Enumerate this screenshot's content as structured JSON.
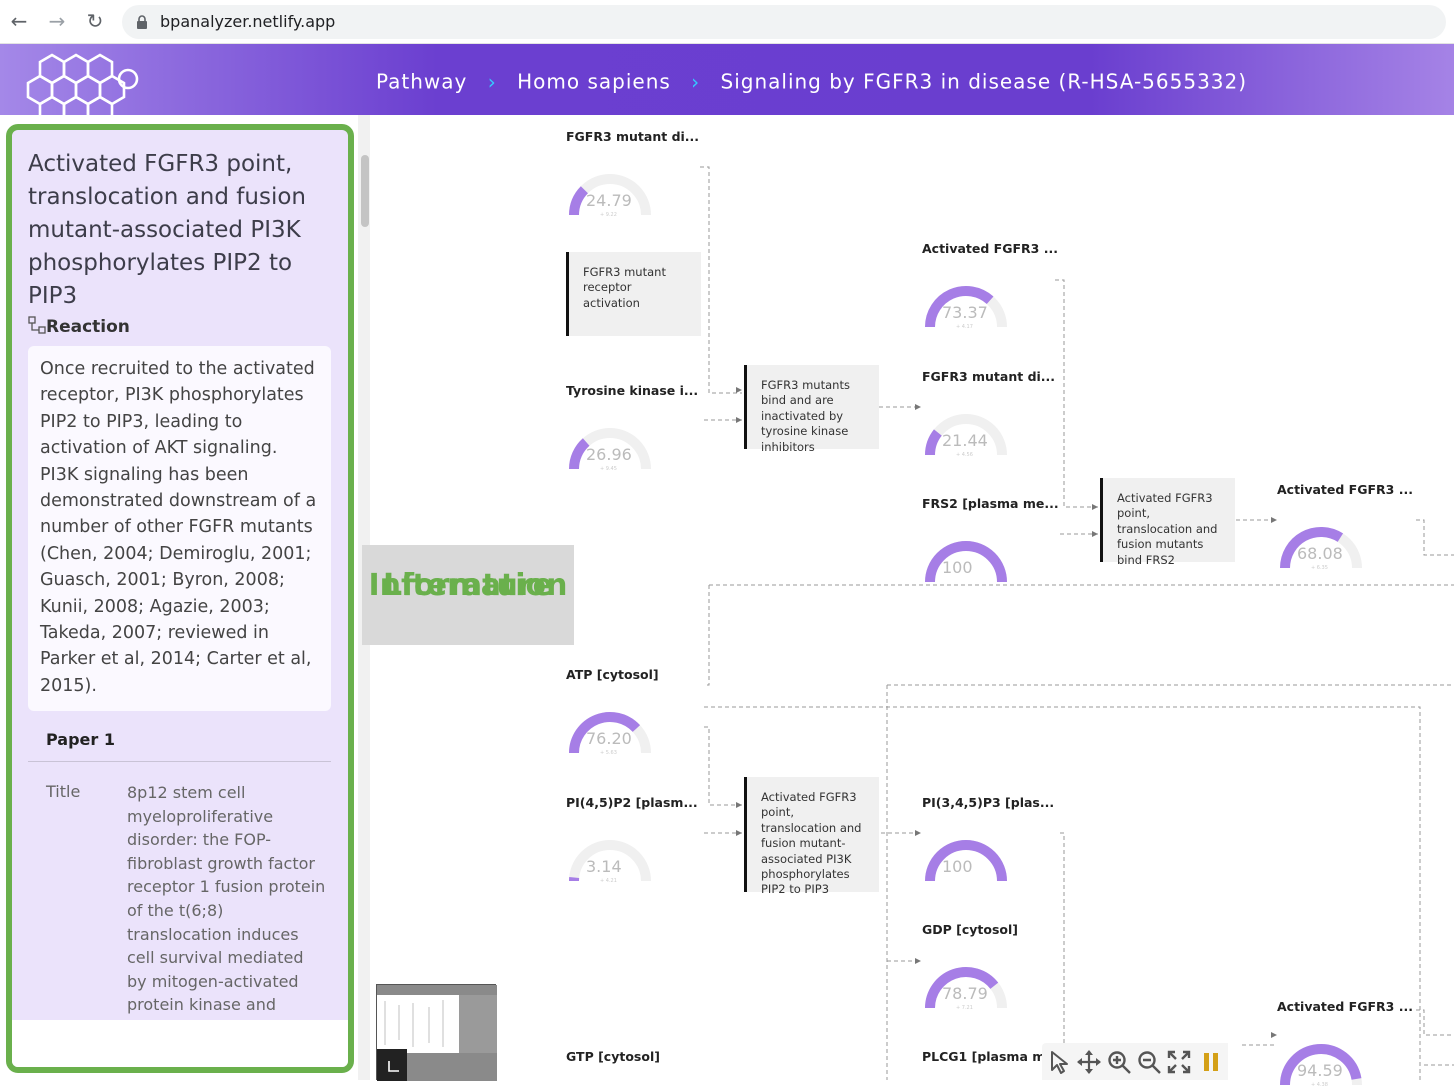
{
  "browser": {
    "url": "bpanalyzer.netlify.app",
    "back_icon": "←",
    "forward_icon": "→",
    "reload_icon": "↻"
  },
  "header": {
    "breadcrumbs": [
      "Pathway",
      "Homo sapiens",
      "Signaling by FGFR3 in disease (R-HSA-5655332)"
    ],
    "separator": "›"
  },
  "panel": {
    "title": "Activated FGFR3 point, translocation and fusion mutant-associated PI3K phosphorylates PIP2 to PIP3",
    "type": "Reaction",
    "description": "Once recruited to the activated receptor, PI3K phosphorylates PIP2 to PIP3, leading to activation of AKT signaling. PI3K signaling has been demonstrated downstream of a number of other FGFR mutants (Chen, 2004; Demiroglu, 2001; Guasch, 2001; Byron, 2008; Kunii, 2008; Agazie, 2003; Takeda, 2007; reviewed in Parker et al, 2014; Carter et al, 2015).",
    "paper_heading": "Paper 1",
    "paper_title_label": "Title",
    "paper_title": "8p12 stem cell myeloproliferative disorder: the FOP-fibroblast growth factor receptor 1 fusion protein of the t(6;8) translocation induces cell survival mediated by mitogen-activated protein kinase and"
  },
  "overlay": {
    "line1": "Literature",
    "line2": "Information"
  },
  "diagram": {
    "nodes": [
      {
        "label": "FGFR3 mutant di...",
        "value": "24.79",
        "sub": "+ 9.22",
        "fill": 0.2479
      },
      {
        "label": "Tyrosine kinase i...",
        "value": "26.96",
        "sub": "+ 9.45",
        "fill": 0.2696
      },
      {
        "label": "Activated FGFR3 ...",
        "value": "73.37",
        "sub": "+ 4.17",
        "fill": 0.7337
      },
      {
        "label": "FGFR3 mutant di...",
        "value": "21.44",
        "sub": "+ 4.56",
        "fill": 0.2144
      },
      {
        "label": "FRS2 [plasma me...",
        "value": "100",
        "sub": "",
        "fill": 1.0
      },
      {
        "label": "Activated FGFR3 ...",
        "value": "68.08",
        "sub": "+ 6.35",
        "fill": 0.6808
      },
      {
        "label": "ATP [cytosol]",
        "value": "76.20",
        "sub": "+ 5.63",
        "fill": 0.762
      },
      {
        "label": "PI(4,5)P2 [plasm...",
        "value": "3.14",
        "sub": "+ 4.21",
        "fill": 0.0314
      },
      {
        "label": "PI(3,4,5)P3 [plas...",
        "value": "100",
        "sub": "",
        "fill": 1.0
      },
      {
        "label": "GDP [cytosol]",
        "value": "78.79",
        "sub": "+ 7.21",
        "fill": 0.7879
      },
      {
        "label": "Activated FGFR3 ...",
        "value": "94.59",
        "sub": "+ 4.38",
        "fill": 0.9459
      },
      {
        "label": "GTP [cytosol]",
        "value": "",
        "sub": "",
        "fill": 0
      },
      {
        "label": "PLCG1 [plasma m...",
        "value": "",
        "sub": "",
        "fill": 0
      }
    ],
    "reactions": [
      "FGFR3 mutant receptor activation",
      "FGFR3 mutants bind and are inactivated by tyrosine kinase inhibitors",
      "Activated FGFR3 point, translocation and fusion mutants bind FRS2",
      "Activated FGFR3 point, translocation and fusion mutant-associated PI3K phosphorylates PIP2 to PIP3"
    ],
    "gauge_color": "#a67ee6",
    "gauge_track": "#f0f0f0"
  },
  "toolbar": {
    "tools": [
      "pointer-icon",
      "move-icon",
      "zoom-in-icon",
      "zoom-out-icon",
      "fit-screen-icon",
      "pause-icon"
    ]
  }
}
